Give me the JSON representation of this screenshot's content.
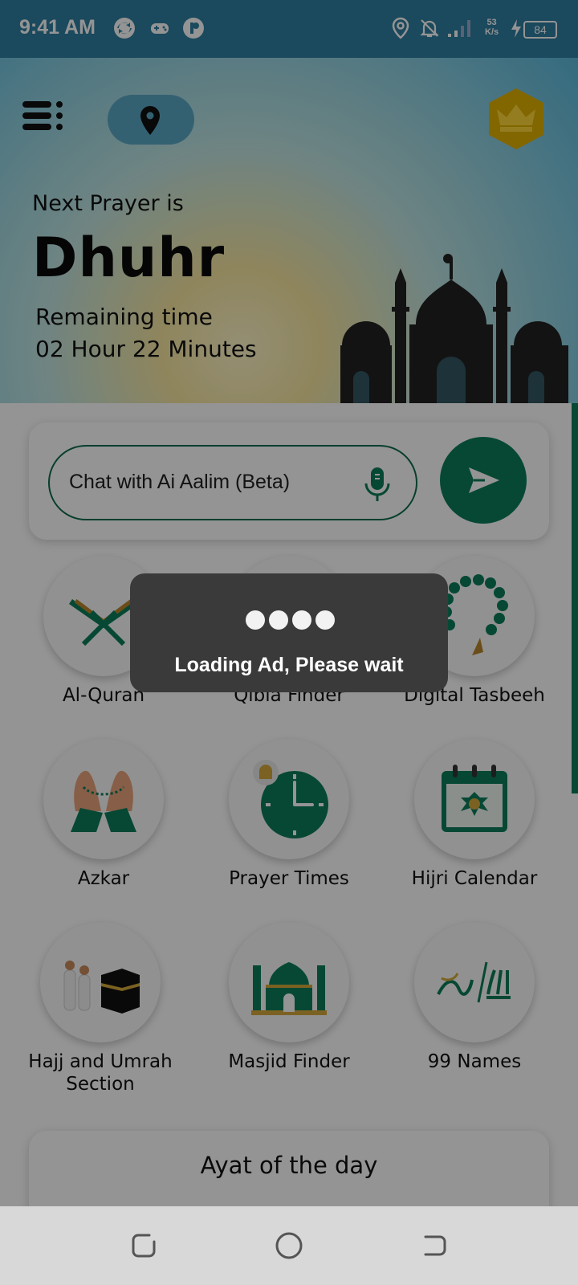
{
  "status_bar": {
    "time": "9:41 AM",
    "net_speed_value": "53",
    "net_speed_unit": "K/s",
    "battery": "84",
    "icons": [
      "sync-icon",
      "gamepad-icon",
      "app-p-icon",
      "location-icon",
      "bell-off-icon",
      "signal-icon",
      "charging-icon",
      "battery-icon"
    ]
  },
  "header": {
    "next_label": "Next Prayer is",
    "prayer_name": "Dhuhr",
    "remaining_label": "Remaining time",
    "remaining_value": "02 Hour 22 Minutes",
    "icons": [
      "menu-icon",
      "location-pin-icon",
      "premium-crown-icon"
    ]
  },
  "chat": {
    "placeholder": "Chat with Ai Aalim (Beta)",
    "icons": [
      "microphone-icon",
      "send-icon"
    ]
  },
  "features": [
    {
      "label": "Al-Quran",
      "icon": "quran-icon"
    },
    {
      "label": "Qibla Finder",
      "icon": "kaaba-compass-icon"
    },
    {
      "label": "Digital Tasbeeh",
      "icon": "tasbeeh-beads-icon"
    },
    {
      "label": "Azkar",
      "icon": "praying-hands-icon"
    },
    {
      "label": "Prayer Times",
      "icon": "clock-icon"
    },
    {
      "label": "Hijri Calendar",
      "icon": "calendar-icon"
    },
    {
      "label": "Hajj and Umrah Section",
      "icon": "hajj-icon"
    },
    {
      "label": "Masjid Finder",
      "icon": "mosque-icon"
    },
    {
      "label": "99 Names",
      "icon": "calligraphy-icon"
    }
  ],
  "ayat": {
    "title": "Ayat of the day"
  },
  "loading": {
    "message": "Loading Ad, Please wait"
  },
  "colors": {
    "accent": "#0c7d5a",
    "header_sky": "#5ab8da",
    "toast_bg": "#3a3a3a"
  }
}
